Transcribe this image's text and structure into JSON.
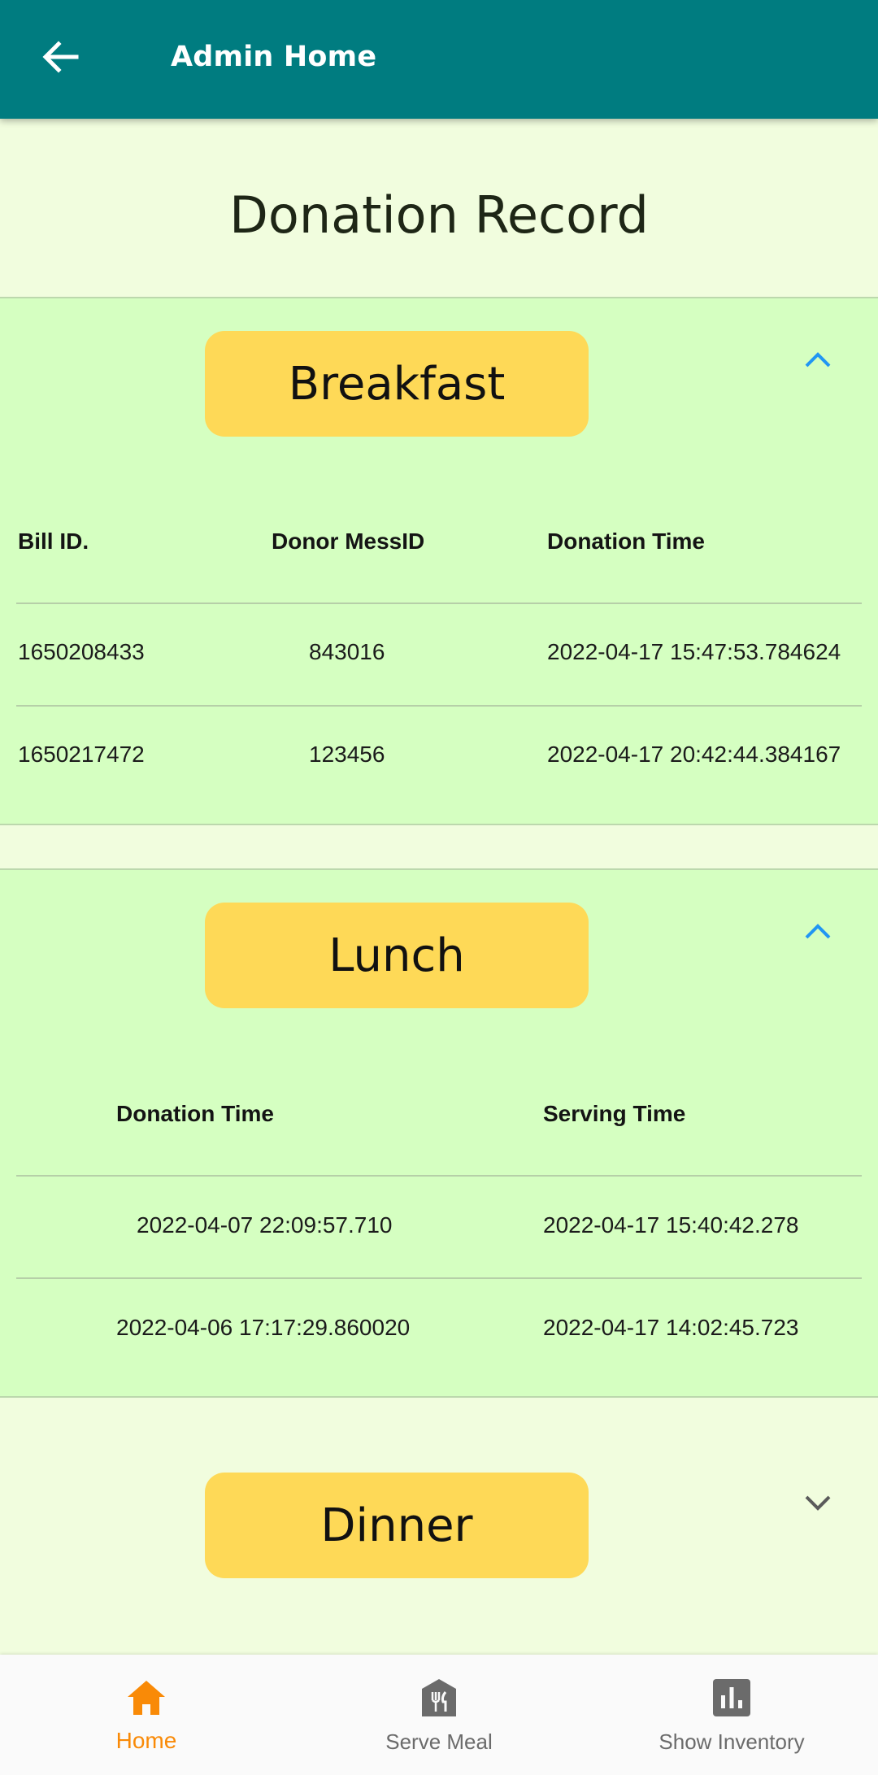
{
  "appbar": {
    "title": "Admin Home",
    "back_icon": "arrow-left-icon"
  },
  "page": {
    "title": "Donation Record"
  },
  "colors": {
    "appbar": "#007c80",
    "background": "#f1fdde",
    "panel": "#d5ffc1",
    "meal_button": "#fed957",
    "accent_blue": "#2196f3",
    "nav_active": "#f98a07"
  },
  "breakfast": {
    "label": "Breakfast",
    "expanded": true,
    "columns": [
      "Bill ID.",
      "Donor MessID",
      "Donation Time"
    ],
    "rows": [
      [
        "1650208433",
        "843016",
        "2022-04-17 15:47:53.784624"
      ],
      [
        "1650217472",
        "123456",
        "2022-04-17 20:42:44.384167"
      ]
    ]
  },
  "lunch": {
    "label": "Lunch",
    "expanded": true,
    "columns": [
      "Donation Time",
      "Serving Time"
    ],
    "rows": [
      [
        "2022-04-07 22:09:57.710",
        "2022-04-17 15:40:42.278"
      ],
      [
        "2022-04-06 17:17:29.860020",
        "2022-04-17 14:02:45.723"
      ]
    ]
  },
  "dinner": {
    "label": "Dinner",
    "expanded": false
  },
  "nav": {
    "items": [
      {
        "label": "Home",
        "icon": "home-icon",
        "active": true
      },
      {
        "label": "Serve Meal",
        "icon": "restaurant-icon",
        "active": false
      },
      {
        "label": "Show Inventory",
        "icon": "bar-chart-icon",
        "active": false
      }
    ]
  }
}
